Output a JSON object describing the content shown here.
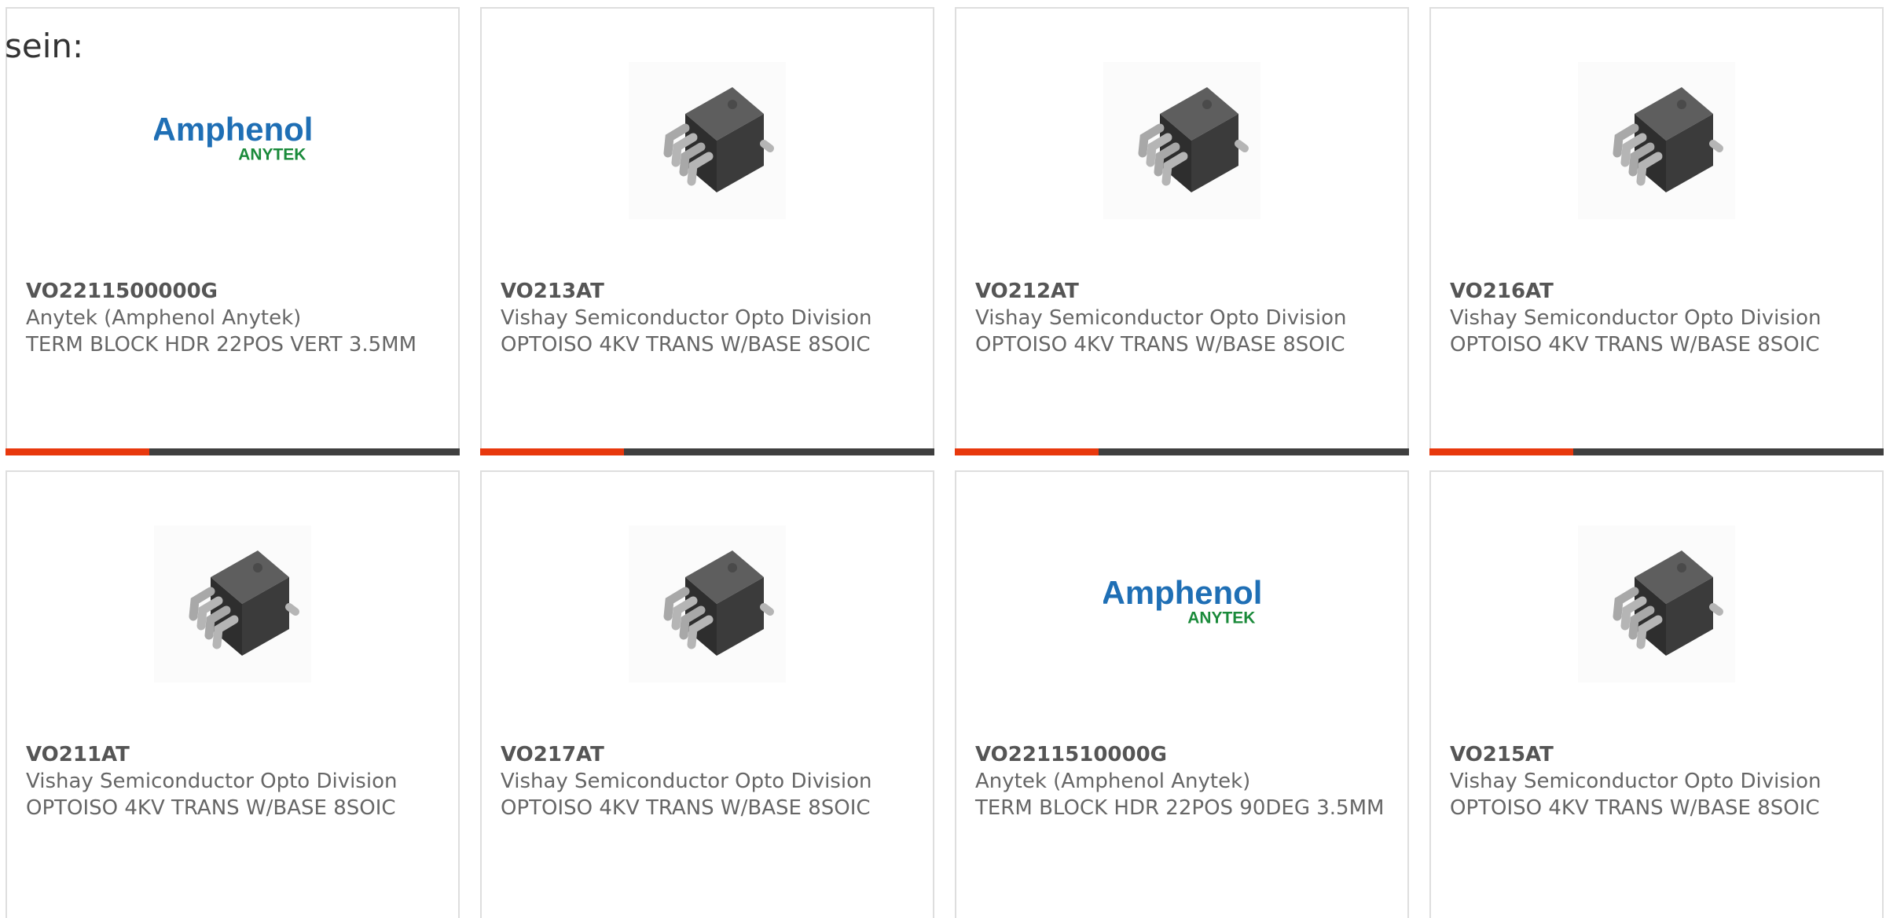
{
  "lead_text": "sein:",
  "colors": {
    "accent": "#e8380d",
    "bar": "#3f3f3f",
    "border": "#dedede"
  },
  "products": [
    {
      "part_number": "VO2211500000G",
      "manufacturer": "Anytek (Amphenol Anytek)",
      "description": "TERM BLOCK HDR 22POS VERT 3.5MM",
      "image": "amphenol-anytek-logo",
      "logo_top": "Amphenol",
      "logo_bottom": "ANYTEK"
    },
    {
      "part_number": "VO213AT",
      "manufacturer": "Vishay Semiconductor Opto Division",
      "description": "OPTOISO 4KV TRANS W/BASE 8SOIC",
      "image": "soic-8-chip"
    },
    {
      "part_number": "VO212AT",
      "manufacturer": "Vishay Semiconductor Opto Division",
      "description": "OPTOISO 4KV TRANS W/BASE 8SOIC",
      "image": "soic-8-chip"
    },
    {
      "part_number": "VO216AT",
      "manufacturer": "Vishay Semiconductor Opto Division",
      "description": "OPTOISO 4KV TRANS W/BASE 8SOIC",
      "image": "soic-8-chip"
    },
    {
      "part_number": "VO211AT",
      "manufacturer": "Vishay Semiconductor Opto Division",
      "description": "OPTOISO 4KV TRANS W/BASE 8SOIC",
      "image": "soic-8-chip"
    },
    {
      "part_number": "VO217AT",
      "manufacturer": "Vishay Semiconductor Opto Division",
      "description": "OPTOISO 4KV TRANS W/BASE 8SOIC",
      "image": "soic-8-chip"
    },
    {
      "part_number": "VO2211510000G",
      "manufacturer": "Anytek (Amphenol Anytek)",
      "description": "TERM BLOCK HDR 22POS 90DEG 3.5MM",
      "image": "amphenol-anytek-logo",
      "logo_top": "Amphenol",
      "logo_bottom": "ANYTEK"
    },
    {
      "part_number": "VO215AT",
      "manufacturer": "Vishay Semiconductor Opto Division",
      "description": "OPTOISO 4KV TRANS W/BASE 8SOIC",
      "image": "soic-8-chip"
    }
  ]
}
